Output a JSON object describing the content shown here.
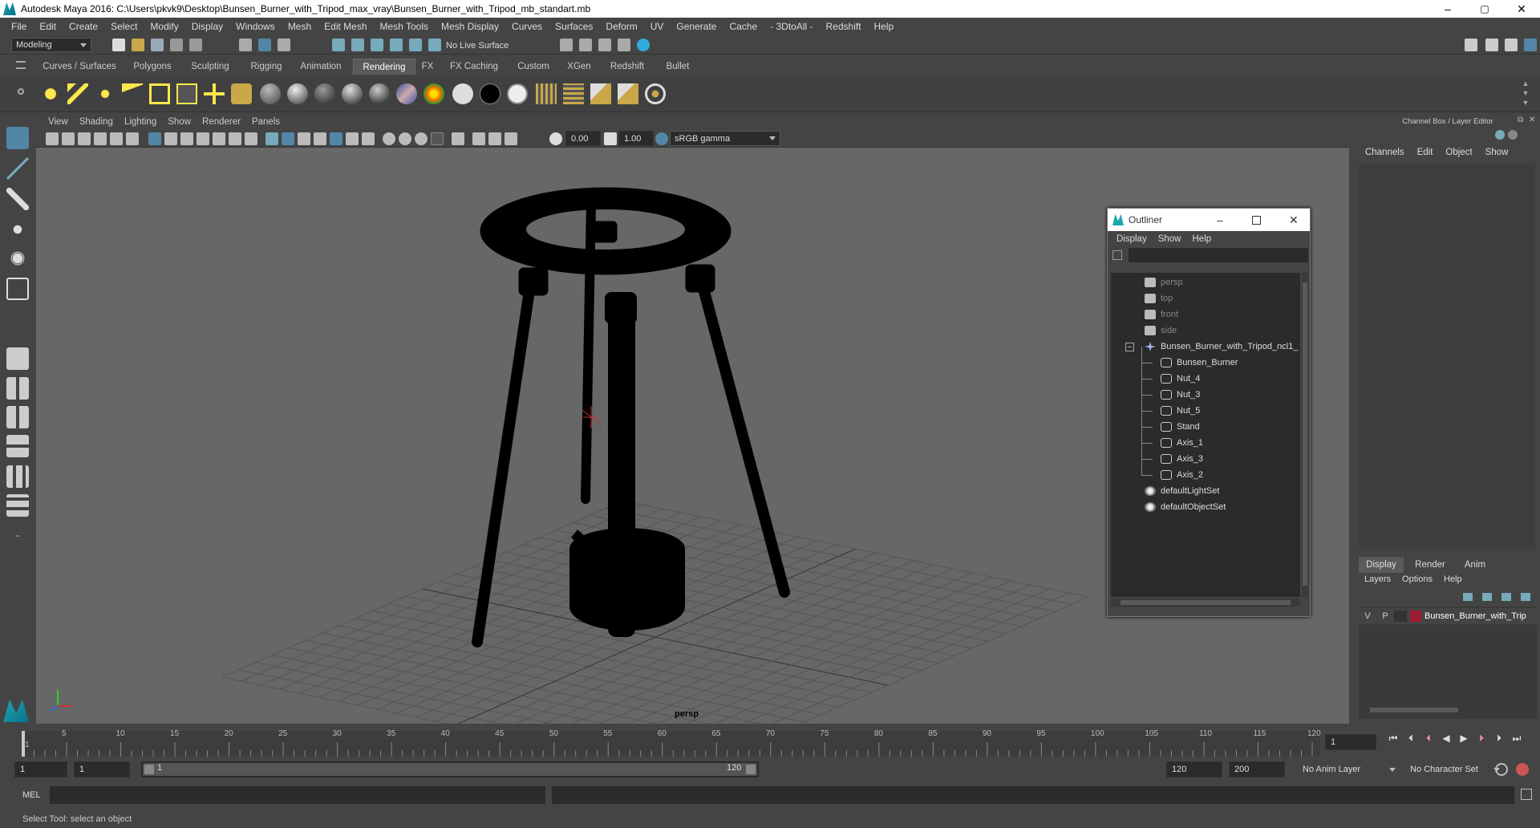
{
  "window": {
    "title": "Autodesk Maya 2016: C:\\Users\\pkvk9\\Desktop\\Bunsen_Burner_with_Tripod_max_vray\\Bunsen_Burner_with_Tripod_mb_standart.mb",
    "minimize": "–",
    "maximize": "▢",
    "close": "✕"
  },
  "menubar": [
    "File",
    "Edit",
    "Create",
    "Select",
    "Modify",
    "Display",
    "Windows",
    "Mesh",
    "Edit Mesh",
    "Mesh Tools",
    "Mesh Display",
    "Curves",
    "Surfaces",
    "Deform",
    "UV",
    "Generate",
    "Cache",
    "- 3DtoAll -",
    "Redshift",
    "Help"
  ],
  "status": {
    "mode": "Modeling",
    "live_surface": "No Live Surface"
  },
  "shelf": {
    "tabs": [
      "Curves / Surfaces",
      "Polygons",
      "Sculpting",
      "Rigging",
      "Animation",
      "Rendering",
      "FX",
      "FX Caching",
      "Custom",
      "XGen",
      "Redshift",
      "Bullet"
    ],
    "active_tab": "Rendering"
  },
  "viewport": {
    "menus": [
      "View",
      "Shading",
      "Lighting",
      "Show",
      "Renderer",
      "Panels"
    ],
    "exposure": "0.00",
    "gamma": "1.00",
    "color_space": "sRGB gamma",
    "camera_label": "persp"
  },
  "outliner": {
    "title": "Outliner",
    "menus": [
      "Display",
      "Show",
      "Help"
    ],
    "items": [
      {
        "label": "persp",
        "type": "camera",
        "indent": 0,
        "dim": true
      },
      {
        "label": "top",
        "type": "camera",
        "indent": 0,
        "dim": true
      },
      {
        "label": "front",
        "type": "camera",
        "indent": 0,
        "dim": true
      },
      {
        "label": "side",
        "type": "camera",
        "indent": 0,
        "dim": true
      },
      {
        "label": "Bunsen_Burner_with_Tripod_ncl1_",
        "type": "group",
        "indent": 0,
        "dim": false
      },
      {
        "label": "Bunsen_Burner",
        "type": "mesh",
        "indent": 1,
        "dim": false
      },
      {
        "label": "Nut_4",
        "type": "mesh",
        "indent": 1,
        "dim": false
      },
      {
        "label": "Nut_3",
        "type": "mesh",
        "indent": 1,
        "dim": false
      },
      {
        "label": "Nut_5",
        "type": "mesh",
        "indent": 1,
        "dim": false
      },
      {
        "label": "Stand",
        "type": "mesh",
        "indent": 1,
        "dim": false
      },
      {
        "label": "Axis_1",
        "type": "mesh",
        "indent": 1,
        "dim": false
      },
      {
        "label": "Axis_3",
        "type": "mesh",
        "indent": 1,
        "dim": false
      },
      {
        "label": "Axis_2",
        "type": "mesh",
        "indent": 1,
        "dim": false
      },
      {
        "label": "defaultLightSet",
        "type": "set",
        "indent": 0,
        "dim": false
      },
      {
        "label": "defaultObjectSet",
        "type": "set",
        "indent": 0,
        "dim": false
      }
    ]
  },
  "channelbox": {
    "title": "Channel Box / Layer Editor",
    "menus": [
      "Channels",
      "Edit",
      "Object",
      "Show"
    ],
    "layer_tabs": [
      "Display",
      "Render",
      "Anim"
    ],
    "active_layer_tab": "Display",
    "layer_menus": [
      "Layers",
      "Options",
      "Help"
    ],
    "layer": {
      "v": "V",
      "p": "P",
      "name": "Bunsen_Burner_with_Trip",
      "color": "#9b1b30"
    }
  },
  "timeline": {
    "ticks": [
      "1",
      "5",
      "10",
      "15",
      "20",
      "25",
      "30",
      "35",
      "40",
      "45",
      "50",
      "55",
      "60",
      "65",
      "70",
      "75",
      "80",
      "85",
      "90",
      "95",
      "100",
      "105",
      "110",
      "115",
      "120"
    ],
    "current_frame": "1"
  },
  "range": {
    "start": "1",
    "start_inner": "1",
    "slider_start": "1",
    "slider_end": "120",
    "end_inner": "120",
    "end": "200",
    "anim_layer": "No Anim Layer",
    "character_set": "No Character Set"
  },
  "cmd": {
    "label": "MEL"
  },
  "help": {
    "text": "Select Tool: select an object"
  },
  "colors": {
    "accent": "#5285a6",
    "bg": "#444444",
    "viewport": "#676767"
  }
}
